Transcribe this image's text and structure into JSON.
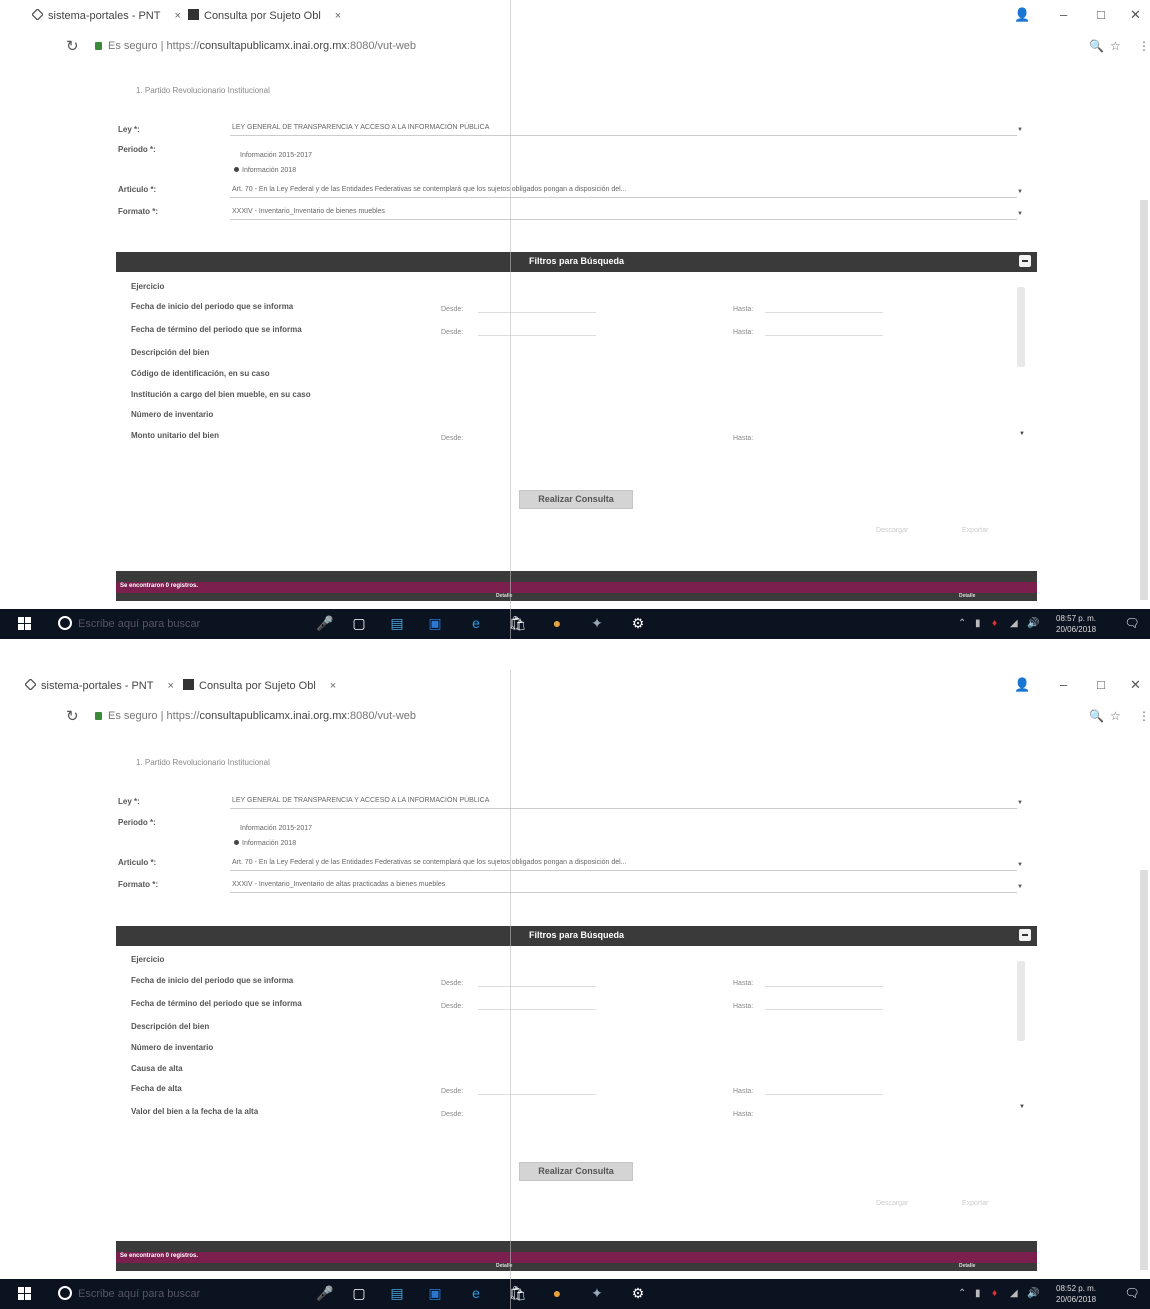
{
  "browser": {
    "tab1_title": "sistema-portales - PNT",
    "tab2_title": "Consulta por Sujeto Obl",
    "tab_close": "×",
    "secure_label": "Es seguro",
    "url_scheme": "https",
    "url_host": "consultapublicamx.inai.org.mx",
    "url_rest": ":8080/vut-web"
  },
  "screen1": {
    "breadcrumb": "1. Partido Revolucionario Institucional",
    "labels": {
      "ley": "Ley *:",
      "periodo": "Periodo *:",
      "articulo": "Articulo *:",
      "formato": "Formato *:"
    },
    "ley_value": "LEY GENERAL DE TRANSPARENCIA Y ACCESO A LA INFORMACIÓN PÚBLICA",
    "periodo_option1": "Información 2015-2017",
    "periodo_option2": "Información 2018",
    "articulo_value": "Art. 70 - En la Ley Federal y de las Entidades Federativas se contemplará que los sujetos obligados pongan a disposición del...",
    "formato_value": "XXXIV - Inventario_Inventario de bienes muebles",
    "filters_title": "Filtros para Búsqueda",
    "filters": [
      "Ejercicio",
      "Fecha de inicio del periodo que se informa",
      "Fecha de término del periodo que se informa",
      "Descripción del bien",
      "Código de identificación, en su caso",
      "Institución a cargo del bien mueble, en su caso",
      "Número de inventario",
      "Monto unitario del bien"
    ],
    "desde": "Desde:",
    "hasta": "Hasta:",
    "submit": "Realizar Consulta",
    "pag_left": "Descargar",
    "pag_right": "Exportar",
    "results": "Se encontraron 0 registros.",
    "col_detalle": "Detalle",
    "col_detalle2": "Detalle",
    "time": "08:57 p. m.",
    "date": "20/06/2018",
    "search_placeholder": "Escribe aquí para buscar"
  },
  "screen2": {
    "breadcrumb": "1. Partido Revolucionario Institucional",
    "labels": {
      "ley": "Ley *:",
      "periodo": "Periodo *:",
      "articulo": "Articulo *:",
      "formato": "Formato *:"
    },
    "ley_value": "LEY GENERAL DE TRANSPARENCIA Y ACCESO A LA INFORMACIÓN PÚBLICA",
    "periodo_option1": "Información 2015-2017",
    "periodo_option2": "Información 2018",
    "articulo_value": "Art. 70 - En la Ley Federal y de las Entidades Federativas se contemplará que los sujetos obligados pongan a disposición del...",
    "formato_value": "XXXIV - Inventario_Inventario de altas practicadas a bienes muebles",
    "filters_title": "Filtros para Búsqueda",
    "filters": [
      "Ejercicio",
      "Fecha de inicio del periodo que se informa",
      "Fecha de término del periodo que se informa",
      "Descripción del bien",
      "Número de inventario",
      "Causa de alta",
      "Fecha de alta",
      "Valor del bien a la fecha de la alta"
    ],
    "desde": "Desde:",
    "hasta": "Hasta:",
    "submit": "Realizar Consulta",
    "pag_left": "Descargar",
    "pag_right": "Exportar",
    "results": "Se encontraron 0 registros.",
    "col_detalle": "Detalle",
    "col_detalle2": "Detalle",
    "time": "08:52 p. m.",
    "date": "20/06/2018",
    "search_placeholder": "Escribe aquí para buscar"
  }
}
